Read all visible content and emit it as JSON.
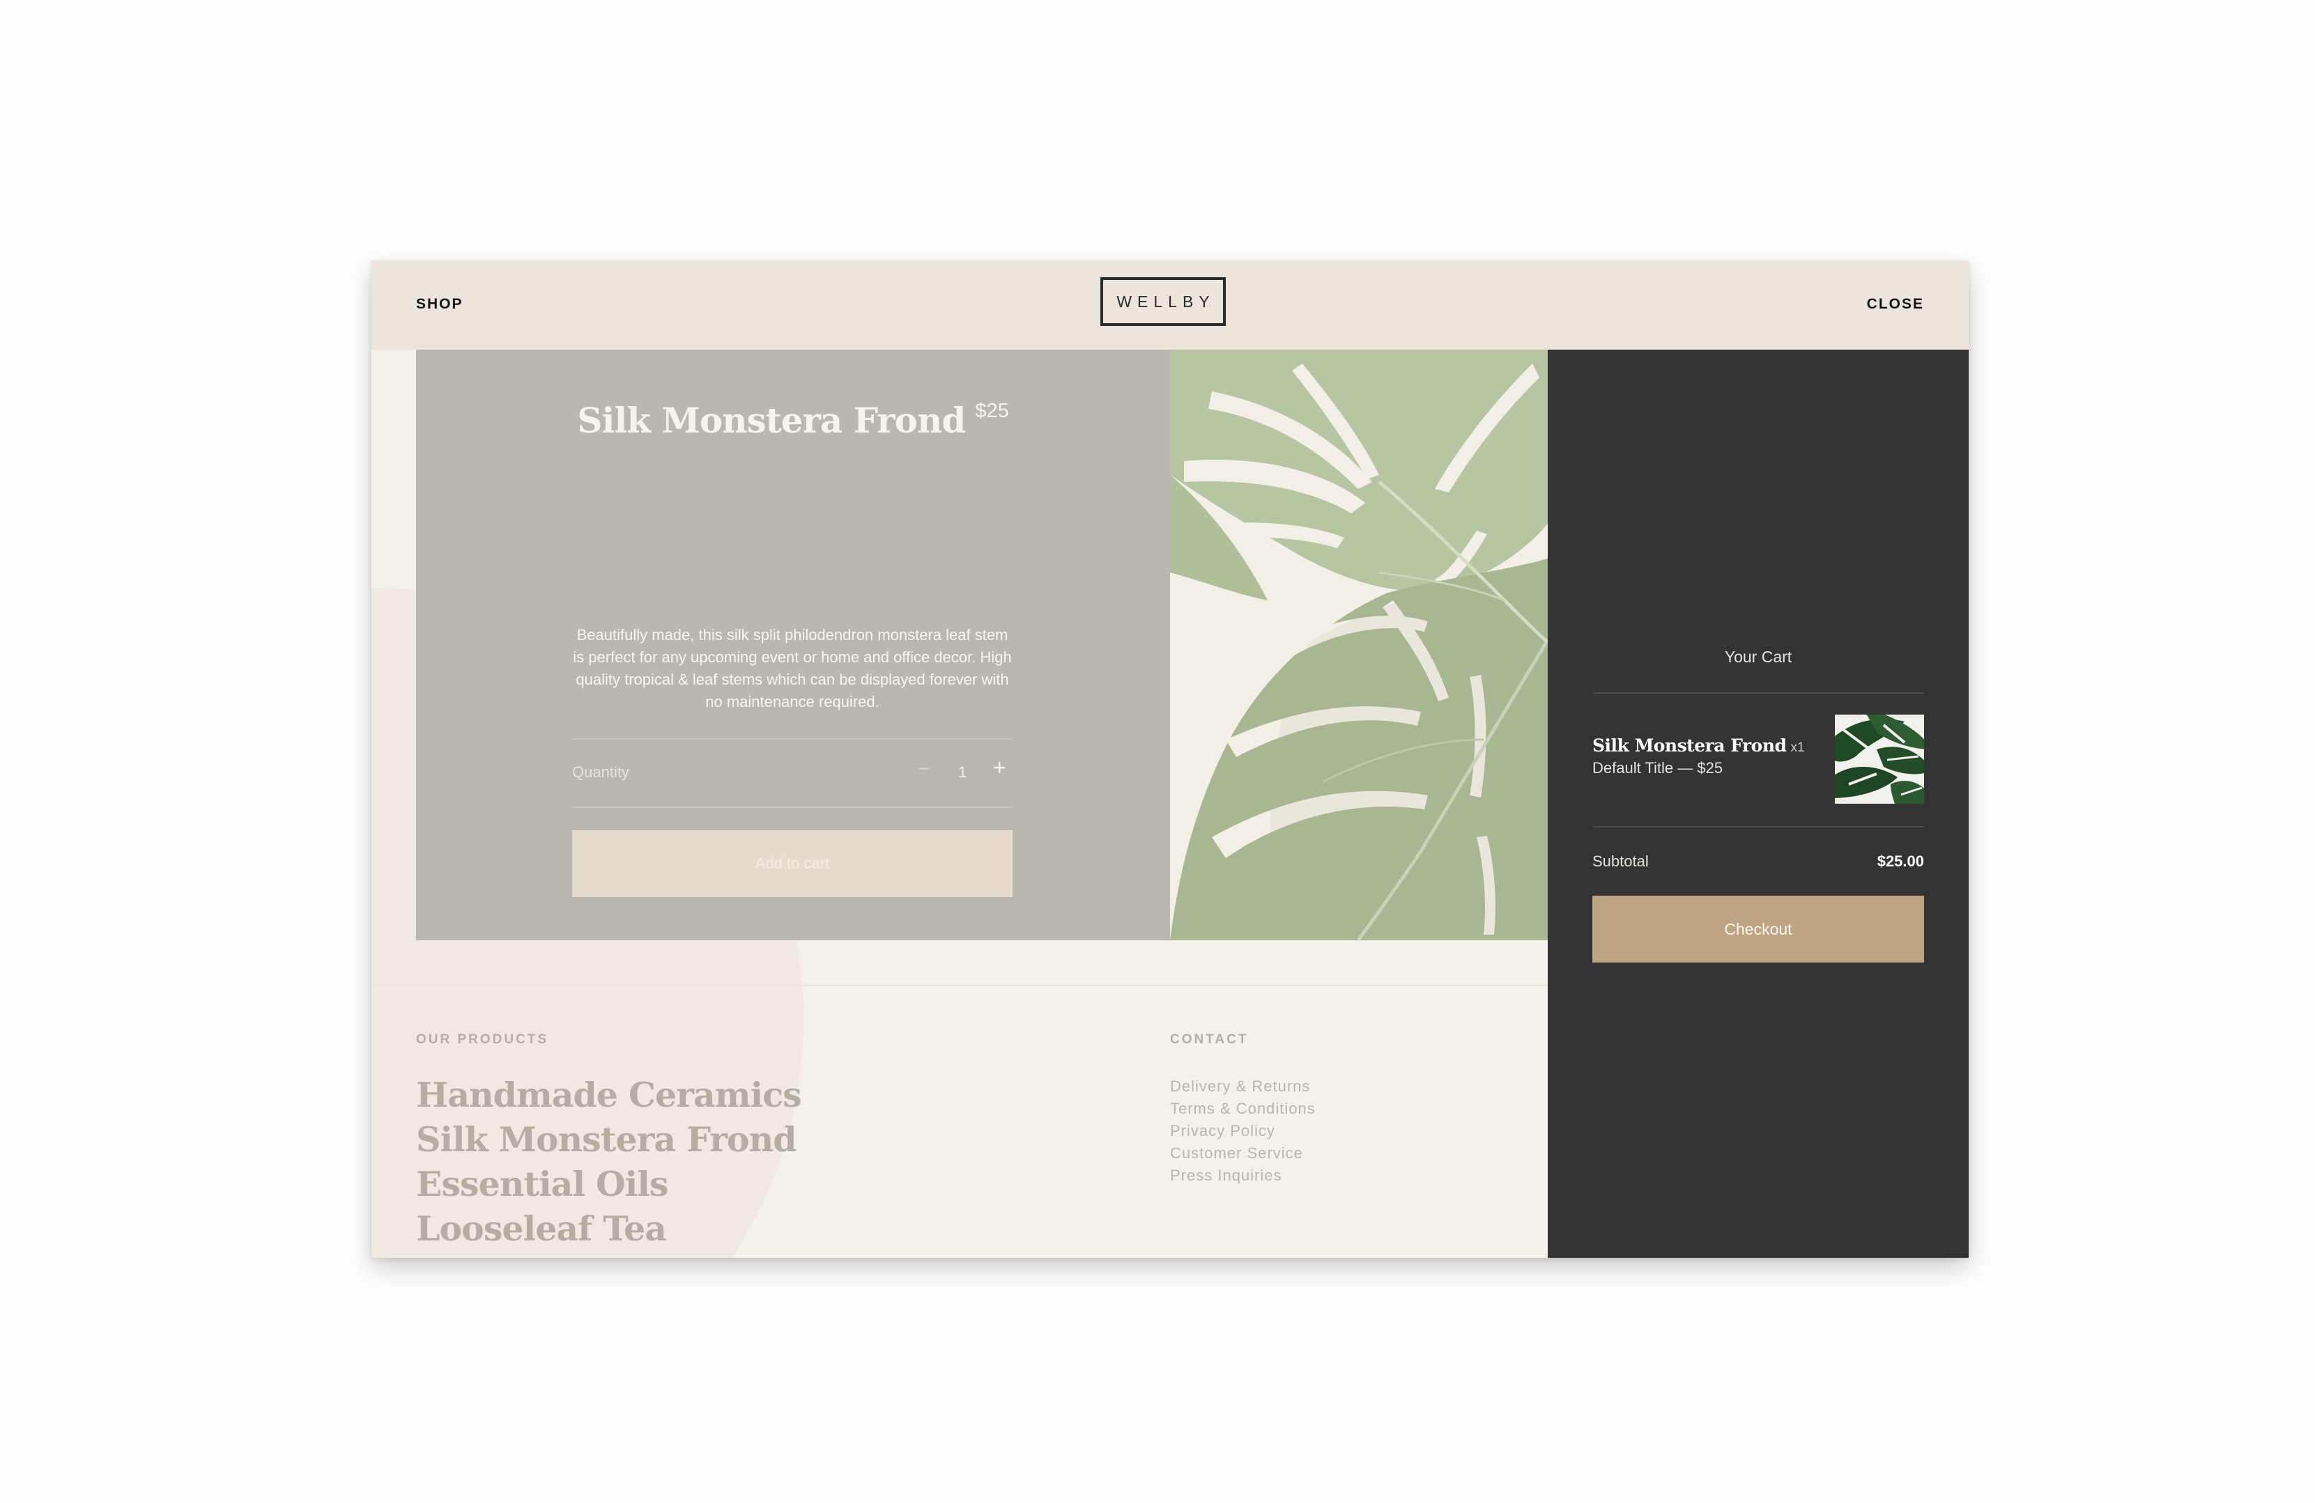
{
  "header": {
    "shop_label": "SHOP",
    "logo_text": "WELLBY",
    "close_label": "CLOSE"
  },
  "product": {
    "title": "Silk Monstera Frond",
    "price": "$25",
    "description": "Beautifully made, this silk split philodendron monstera leaf stem is perfect for any upcoming event or home and office decor. High quality tropical & leaf stems which can be displayed forever with no maintenance required.",
    "quantity_label": "Quantity",
    "quantity_value": "1",
    "minus_symbol": "−",
    "plus_symbol": "+",
    "add_to_cart_label": "Add to cart",
    "image_icon": "monstera-leaf-image"
  },
  "footer": {
    "products_heading": "OUR PRODUCTS",
    "products": [
      "Handmade Ceramics",
      "Silk Monstera Frond",
      "Essential Oils",
      "Looseleaf Tea"
    ],
    "contact_heading": "CONTACT",
    "contact_links": [
      "Delivery & Returns",
      "Terms & Conditions",
      "Privacy Policy",
      "Customer Service",
      "Press Inquiries"
    ]
  },
  "cart": {
    "title": "Your Cart",
    "item": {
      "name": "Silk Monstera Frond",
      "quantity": "x1",
      "variant": "Default Title — $25",
      "thumb_icon": "monstera-leaf-thumbnail"
    },
    "subtotal_label": "Subtotal",
    "subtotal_value": "$25.00",
    "checkout_label": "Checkout"
  },
  "colors": {
    "header_bg": "#ece5dc",
    "product_panel_bg": "#bab7b0",
    "cart_bg": "#333333",
    "checkout_bg": "#bea482",
    "add_to_cart_bg": "#e5dacb",
    "leaf_green": "#9fb48c"
  }
}
